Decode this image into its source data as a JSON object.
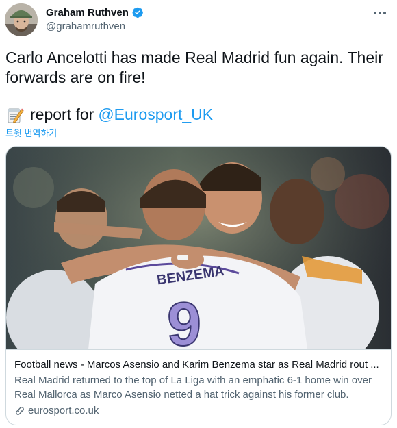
{
  "author": {
    "name": "Graham Ruthven",
    "handle": "@grahamruthven",
    "verified": true
  },
  "tweet": {
    "text": "Carlo Ancelotti has made Real Madrid fun again. Their forwards are on fire!",
    "report_text": "report for",
    "mention": "@Eurosport_UK",
    "memo_icon": "memo-icon",
    "translate_label": "트윗 번역하기"
  },
  "card": {
    "title": "Football news - Marcos Asensio and Karim Benzema star as Real Madrid rout ...",
    "description": "Real Madrid returned to the top of La Liga with an emphatic 6-1 home win over Real Mallorca as Marco Asensio netted a hat trick against his former club.",
    "domain": "eurosport.co.uk"
  },
  "colors": {
    "accent": "#1d9bf0",
    "text": "#0f1419",
    "secondary": "#536471",
    "border": "#cfd9de"
  }
}
